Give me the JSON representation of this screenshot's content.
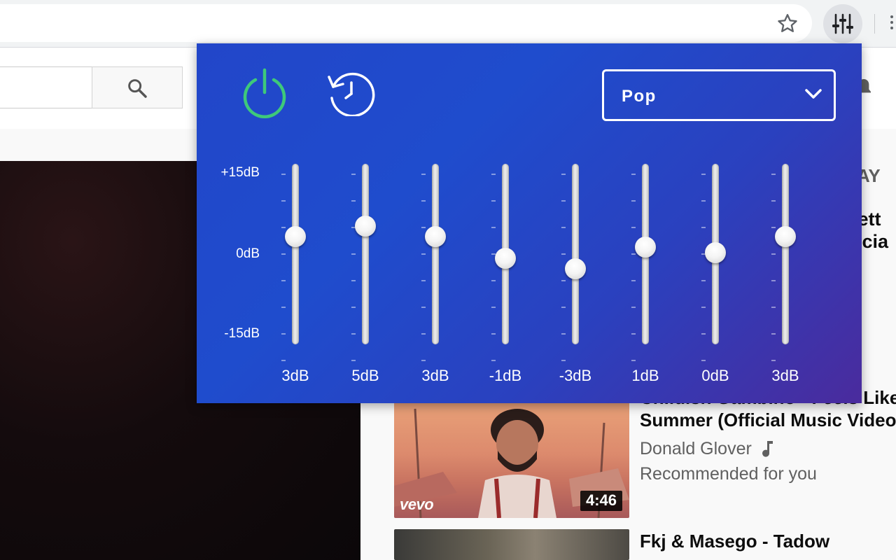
{
  "popup": {
    "preset": "Pop",
    "scale_labels": [
      "+15dB",
      "0dB",
      "-15dB"
    ],
    "db_range": [
      -15,
      15
    ],
    "accent_power": "#3ec97a",
    "bands": [
      {
        "label": "3dB",
        "gain": 3
      },
      {
        "label": "5dB",
        "gain": 5
      },
      {
        "label": "3dB",
        "gain": 3
      },
      {
        "label": "-1dB",
        "gain": -1
      },
      {
        "label": "-3dB",
        "gain": -3
      },
      {
        "label": "1dB",
        "gain": 1
      },
      {
        "label": "0dB",
        "gain": 0
      },
      {
        "label": "3dB",
        "gain": 3
      }
    ]
  },
  "toolbar": {
    "icons": [
      "star-icon",
      "equalizer-icon",
      "menu-icon"
    ]
  },
  "page": {
    "up_next_fragment": "AY",
    "partial_titles": [
      "Bett",
      "fficia"
    ],
    "videos": [
      {
        "title_line1": "Childish Gambino - Feels Like",
        "title_line2": "Summer (Official Music Video)",
        "channel": "Donald Glover",
        "meta": "Recommended for you",
        "duration": "4:46",
        "badge": "vevo"
      },
      {
        "title_line1": "Fkj & Masego - Tadow"
      }
    ]
  }
}
